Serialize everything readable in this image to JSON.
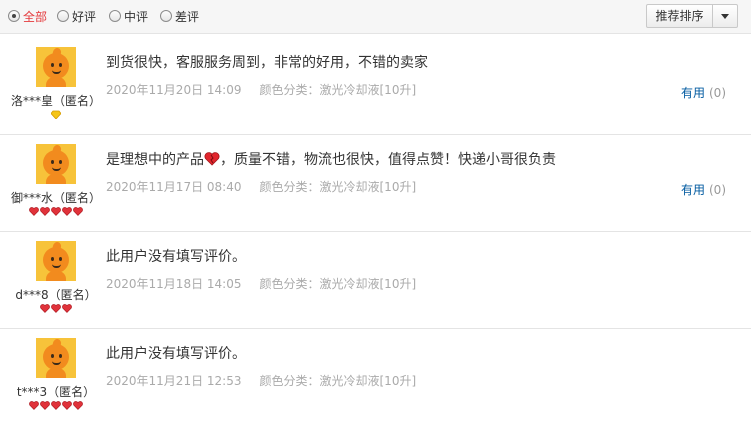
{
  "filters": {
    "all": "全部",
    "good": "好评",
    "medium": "中评",
    "bad": "差评",
    "selected": "all"
  },
  "sort": {
    "label": "推荐排序"
  },
  "colors": {
    "accent_red": "#e4393c",
    "link_blue": "#005aa0",
    "meta_gray": "#aaaaaa"
  },
  "reviews": [
    {
      "user": "洛***皇（匿名）",
      "level_icons": [
        "yellow-diamond-icon"
      ],
      "content": "到货很快，客服服务周到，非常的好用，不错的卖家",
      "date": "2020年11月20日 14:09",
      "color_label": "颜色分类：",
      "color_value": "激光冷却液[10升]",
      "useful_label": "有用",
      "useful_count": "(0)"
    },
    {
      "user": "御***水（匿名）",
      "level_icons": [
        "red-heart-icon",
        "red-heart-icon",
        "red-heart-icon",
        "red-heart-icon",
        "red-heart-icon"
      ],
      "content_before": "是理想中的产品",
      "content_after": "，质量不错，物流也很快，值得点赞！快递小哥很负责",
      "date": "2020年11月17日 08:40",
      "color_label": "颜色分类：",
      "color_value": "激光冷却液[10升]",
      "useful_label": "有用",
      "useful_count": "(0)"
    },
    {
      "user": "d***8（匿名）",
      "level_icons": [
        "red-heart-icon",
        "red-heart-icon",
        "red-heart-icon"
      ],
      "content": "此用户没有填写评价。",
      "date": "2020年11月18日 14:05",
      "color_label": "颜色分类：",
      "color_value": "激光冷却液[10升]"
    },
    {
      "user": "t***3（匿名）",
      "level_icons": [
        "red-heart-icon",
        "red-heart-icon",
        "red-heart-icon",
        "red-heart-icon",
        "red-heart-icon"
      ],
      "content": "此用户没有填写评价。",
      "date": "2020年11月21日 12:53",
      "color_label": "颜色分类：",
      "color_value": "激光冷却液[10升]"
    }
  ]
}
